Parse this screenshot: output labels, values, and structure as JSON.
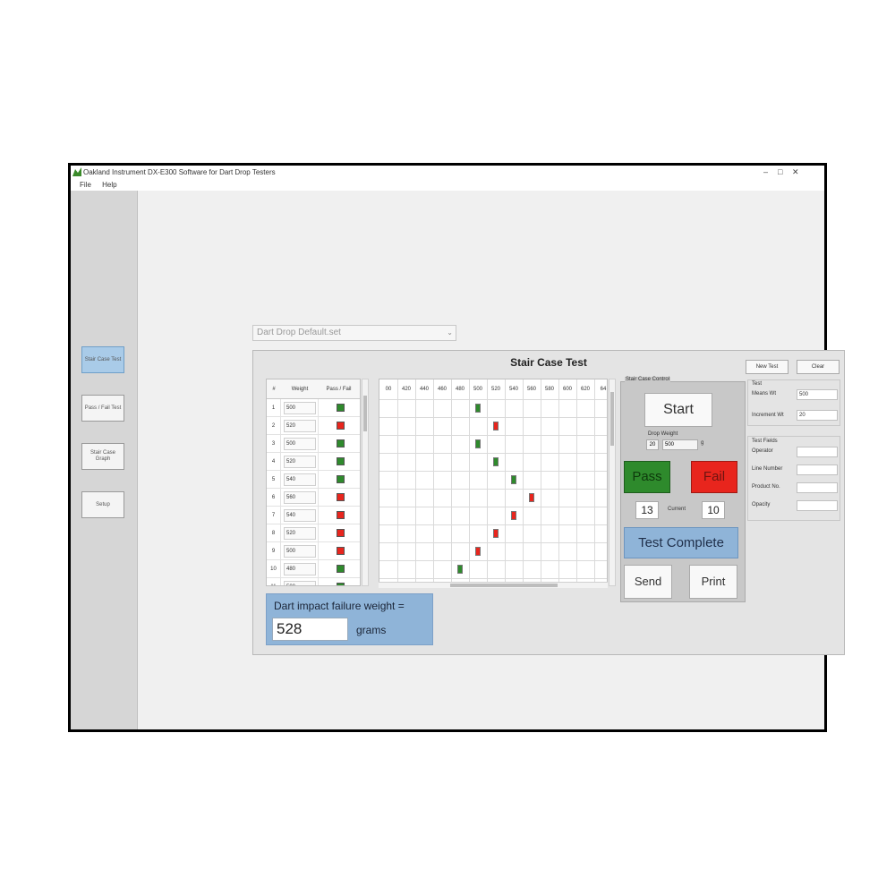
{
  "window": {
    "title": "Oakland Instrument DX-E300 Software for Dart Drop Testers"
  },
  "menu": [
    "File",
    "Help"
  ],
  "sidebar": {
    "buttons": [
      "Stair Case Test",
      "Pass / Fail Test",
      "Stair Case Graph",
      "Setup"
    ]
  },
  "config_select": {
    "value": "Dart Drop Default.set"
  },
  "panel": {
    "title": "Stair Case Test"
  },
  "table": {
    "headers": [
      "#",
      "Weight",
      "Pass / Fail"
    ],
    "rows": [
      {
        "n": "1",
        "weight": "500",
        "result": "pass"
      },
      {
        "n": "2",
        "weight": "520",
        "result": "fail"
      },
      {
        "n": "3",
        "weight": "500",
        "result": "pass"
      },
      {
        "n": "4",
        "weight": "520",
        "result": "pass"
      },
      {
        "n": "5",
        "weight": "540",
        "result": "pass"
      },
      {
        "n": "6",
        "weight": "560",
        "result": "fail"
      },
      {
        "n": "7",
        "weight": "540",
        "result": "fail"
      },
      {
        "n": "8",
        "weight": "520",
        "result": "fail"
      },
      {
        "n": "9",
        "weight": "500",
        "result": "fail"
      },
      {
        "n": "10",
        "weight": "480",
        "result": "pass"
      },
      {
        "n": "11",
        "weight": "500",
        "result": "pass"
      }
    ]
  },
  "grid": {
    "columns": [
      "00",
      "420",
      "440",
      "460",
      "480",
      "500",
      "520",
      "540",
      "560",
      "580",
      "600",
      "620",
      "64"
    ],
    "marks": [
      {
        "row": 1,
        "col": 5,
        "result": "pass"
      },
      {
        "row": 2,
        "col": 6,
        "result": "fail"
      },
      {
        "row": 3,
        "col": 5,
        "result": "pass"
      },
      {
        "row": 4,
        "col": 6,
        "result": "pass"
      },
      {
        "row": 5,
        "col": 7,
        "result": "pass"
      },
      {
        "row": 6,
        "col": 8,
        "result": "fail"
      },
      {
        "row": 7,
        "col": 7,
        "result": "fail"
      },
      {
        "row": 8,
        "col": 6,
        "result": "fail"
      },
      {
        "row": 9,
        "col": 5,
        "result": "fail"
      },
      {
        "row": 10,
        "col": 4,
        "result": "pass"
      }
    ]
  },
  "control": {
    "label": "Stair Case Control",
    "start_label": "Start",
    "drop_weight_label": "Drop Weight",
    "drop_weight_step": "20",
    "drop_weight_value": "500",
    "drop_weight_unit": "g",
    "pass_label": "Pass",
    "fail_label": "Fail",
    "count_left": "13",
    "current_label": "Current",
    "count_right": "10",
    "status": "Test Complete",
    "send_label": "Send",
    "print_label": "Print"
  },
  "right": {
    "new_test_label": "New Test",
    "clear_label": "Clear",
    "test_group_label": "Test",
    "means_wt_label": "Means Wt",
    "means_wt_value": "500",
    "increment_wt_label": "Increment Wt",
    "increment_wt_value": "20",
    "fields_group_label": "Test Fields",
    "fields": [
      "Operator",
      "Line Number",
      "Product No.",
      "Opacity"
    ]
  },
  "result": {
    "label": "Dart impact failure weight =",
    "value": "528",
    "unit": "grams"
  },
  "colors": {
    "pass": "#2e8a2c",
    "fail": "#e8251d",
    "accent": "#8fb4d8"
  }
}
